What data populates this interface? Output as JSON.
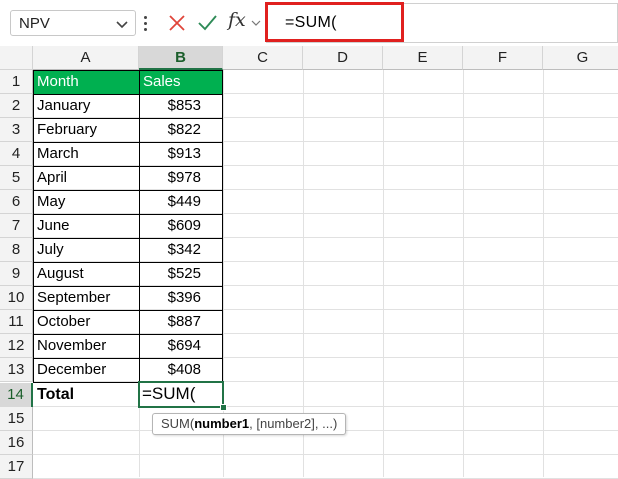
{
  "formula_bar": {
    "name_box": "NPV",
    "fx_label": "fx",
    "formula": "=SUM("
  },
  "columns": [
    "A",
    "B",
    "C",
    "D",
    "E",
    "F",
    "G"
  ],
  "rows": [
    "1",
    "2",
    "3",
    "4",
    "5",
    "6",
    "7",
    "8",
    "9",
    "10",
    "11",
    "12",
    "13",
    "14",
    "15",
    "16",
    "17"
  ],
  "table": {
    "header_month": "Month",
    "header_sales": "Sales",
    "data": [
      {
        "month": "January",
        "sales": "$853"
      },
      {
        "month": "February",
        "sales": "$822"
      },
      {
        "month": "March",
        "sales": "$913"
      },
      {
        "month": "April",
        "sales": "$978"
      },
      {
        "month": "May",
        "sales": "$449"
      },
      {
        "month": "June",
        "sales": "$609"
      },
      {
        "month": "July",
        "sales": "$342"
      },
      {
        "month": "August",
        "sales": "$525"
      },
      {
        "month": "September",
        "sales": "$396"
      },
      {
        "month": "October",
        "sales": "$887"
      },
      {
        "month": "November",
        "sales": "$694"
      },
      {
        "month": "December",
        "sales": "$408"
      }
    ],
    "total_label": "Total",
    "total_value": "=SUM("
  },
  "tooltip": {
    "fn": "SUM(",
    "arg1": "number1",
    "rest": ", [number2], ...)"
  },
  "colors": {
    "header_fill": "#00b050",
    "active_border": "#217346",
    "highlight_box": "#e0201f"
  },
  "selected_column": "B",
  "selected_row": "14"
}
